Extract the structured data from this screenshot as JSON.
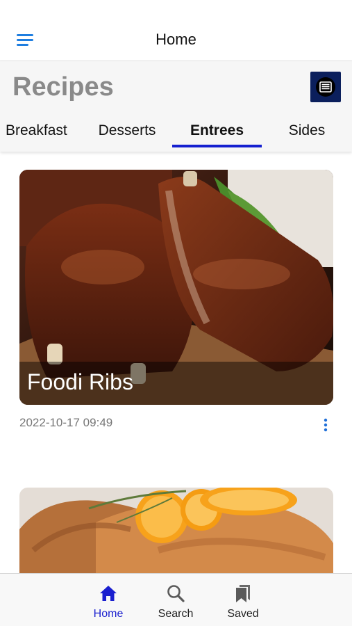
{
  "nav": {
    "title": "Home",
    "menu_icon": "hamburger-menu-icon"
  },
  "header": {
    "title": "Recipes",
    "news_icon": "newspaper-icon",
    "tabs": [
      {
        "label": "Breakfast",
        "active": false
      },
      {
        "label": "Desserts",
        "active": false
      },
      {
        "label": "Entrees",
        "active": true
      },
      {
        "label": "Sides",
        "active": false
      }
    ]
  },
  "recipes": [
    {
      "title": "Foodi Ribs",
      "date": "2022-10-17 09:49",
      "image": "bbq-ribs-photo"
    },
    {
      "title": "",
      "date": "",
      "image": "roast-with-orange-slices-photo"
    }
  ],
  "tabbar": {
    "items": [
      {
        "label": "Home",
        "icon": "home-icon",
        "active": true
      },
      {
        "label": "Search",
        "icon": "search-icon",
        "active": false
      },
      {
        "label": "Saved",
        "icon": "bookmark-icon",
        "active": false
      }
    ]
  },
  "colors": {
    "accent": "#1520d0",
    "header_title": "#8a8a8a",
    "news_button": "#0b1f5c",
    "menu_icon": "#1f7ee0"
  }
}
